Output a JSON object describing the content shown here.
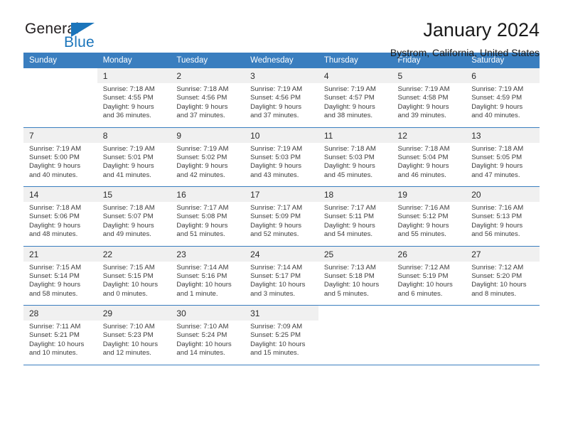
{
  "brand": {
    "name_part1": "General",
    "name_part2": "Blue",
    "triangle_icon": "triangle-icon",
    "accent_color": "#1b75bb"
  },
  "header": {
    "title": "January 2024",
    "subtitle": "Bystrom, California, United States"
  },
  "calendar": {
    "header_color": "#3a7ebf",
    "daynum_band_color": "#f0f0f0",
    "weekday_headers": [
      "Sunday",
      "Monday",
      "Tuesday",
      "Wednesday",
      "Thursday",
      "Friday",
      "Saturday"
    ],
    "weeks": [
      {
        "days": [
          {
            "num": "",
            "sunrise": "",
            "sunset": "",
            "daylight1": "",
            "daylight2": ""
          },
          {
            "num": "1",
            "sunrise": "Sunrise: 7:18 AM",
            "sunset": "Sunset: 4:55 PM",
            "daylight1": "Daylight: 9 hours",
            "daylight2": "and 36 minutes."
          },
          {
            "num": "2",
            "sunrise": "Sunrise: 7:18 AM",
            "sunset": "Sunset: 4:56 PM",
            "daylight1": "Daylight: 9 hours",
            "daylight2": "and 37 minutes."
          },
          {
            "num": "3",
            "sunrise": "Sunrise: 7:19 AM",
            "sunset": "Sunset: 4:56 PM",
            "daylight1": "Daylight: 9 hours",
            "daylight2": "and 37 minutes."
          },
          {
            "num": "4",
            "sunrise": "Sunrise: 7:19 AM",
            "sunset": "Sunset: 4:57 PM",
            "daylight1": "Daylight: 9 hours",
            "daylight2": "and 38 minutes."
          },
          {
            "num": "5",
            "sunrise": "Sunrise: 7:19 AM",
            "sunset": "Sunset: 4:58 PM",
            "daylight1": "Daylight: 9 hours",
            "daylight2": "and 39 minutes."
          },
          {
            "num": "6",
            "sunrise": "Sunrise: 7:19 AM",
            "sunset": "Sunset: 4:59 PM",
            "daylight1": "Daylight: 9 hours",
            "daylight2": "and 40 minutes."
          }
        ]
      },
      {
        "days": [
          {
            "num": "7",
            "sunrise": "Sunrise: 7:19 AM",
            "sunset": "Sunset: 5:00 PM",
            "daylight1": "Daylight: 9 hours",
            "daylight2": "and 40 minutes."
          },
          {
            "num": "8",
            "sunrise": "Sunrise: 7:19 AM",
            "sunset": "Sunset: 5:01 PM",
            "daylight1": "Daylight: 9 hours",
            "daylight2": "and 41 minutes."
          },
          {
            "num": "9",
            "sunrise": "Sunrise: 7:19 AM",
            "sunset": "Sunset: 5:02 PM",
            "daylight1": "Daylight: 9 hours",
            "daylight2": "and 42 minutes."
          },
          {
            "num": "10",
            "sunrise": "Sunrise: 7:19 AM",
            "sunset": "Sunset: 5:03 PM",
            "daylight1": "Daylight: 9 hours",
            "daylight2": "and 43 minutes."
          },
          {
            "num": "11",
            "sunrise": "Sunrise: 7:18 AM",
            "sunset": "Sunset: 5:03 PM",
            "daylight1": "Daylight: 9 hours",
            "daylight2": "and 45 minutes."
          },
          {
            "num": "12",
            "sunrise": "Sunrise: 7:18 AM",
            "sunset": "Sunset: 5:04 PM",
            "daylight1": "Daylight: 9 hours",
            "daylight2": "and 46 minutes."
          },
          {
            "num": "13",
            "sunrise": "Sunrise: 7:18 AM",
            "sunset": "Sunset: 5:05 PM",
            "daylight1": "Daylight: 9 hours",
            "daylight2": "and 47 minutes."
          }
        ]
      },
      {
        "days": [
          {
            "num": "14",
            "sunrise": "Sunrise: 7:18 AM",
            "sunset": "Sunset: 5:06 PM",
            "daylight1": "Daylight: 9 hours",
            "daylight2": "and 48 minutes."
          },
          {
            "num": "15",
            "sunrise": "Sunrise: 7:18 AM",
            "sunset": "Sunset: 5:07 PM",
            "daylight1": "Daylight: 9 hours",
            "daylight2": "and 49 minutes."
          },
          {
            "num": "16",
            "sunrise": "Sunrise: 7:17 AM",
            "sunset": "Sunset: 5:08 PM",
            "daylight1": "Daylight: 9 hours",
            "daylight2": "and 51 minutes."
          },
          {
            "num": "17",
            "sunrise": "Sunrise: 7:17 AM",
            "sunset": "Sunset: 5:09 PM",
            "daylight1": "Daylight: 9 hours",
            "daylight2": "and 52 minutes."
          },
          {
            "num": "18",
            "sunrise": "Sunrise: 7:17 AM",
            "sunset": "Sunset: 5:11 PM",
            "daylight1": "Daylight: 9 hours",
            "daylight2": "and 54 minutes."
          },
          {
            "num": "19",
            "sunrise": "Sunrise: 7:16 AM",
            "sunset": "Sunset: 5:12 PM",
            "daylight1": "Daylight: 9 hours",
            "daylight2": "and 55 minutes."
          },
          {
            "num": "20",
            "sunrise": "Sunrise: 7:16 AM",
            "sunset": "Sunset: 5:13 PM",
            "daylight1": "Daylight: 9 hours",
            "daylight2": "and 56 minutes."
          }
        ]
      },
      {
        "days": [
          {
            "num": "21",
            "sunrise": "Sunrise: 7:15 AM",
            "sunset": "Sunset: 5:14 PM",
            "daylight1": "Daylight: 9 hours",
            "daylight2": "and 58 minutes."
          },
          {
            "num": "22",
            "sunrise": "Sunrise: 7:15 AM",
            "sunset": "Sunset: 5:15 PM",
            "daylight1": "Daylight: 10 hours",
            "daylight2": "and 0 minutes."
          },
          {
            "num": "23",
            "sunrise": "Sunrise: 7:14 AM",
            "sunset": "Sunset: 5:16 PM",
            "daylight1": "Daylight: 10 hours",
            "daylight2": "and 1 minute."
          },
          {
            "num": "24",
            "sunrise": "Sunrise: 7:14 AM",
            "sunset": "Sunset: 5:17 PM",
            "daylight1": "Daylight: 10 hours",
            "daylight2": "and 3 minutes."
          },
          {
            "num": "25",
            "sunrise": "Sunrise: 7:13 AM",
            "sunset": "Sunset: 5:18 PM",
            "daylight1": "Daylight: 10 hours",
            "daylight2": "and 5 minutes."
          },
          {
            "num": "26",
            "sunrise": "Sunrise: 7:12 AM",
            "sunset": "Sunset: 5:19 PM",
            "daylight1": "Daylight: 10 hours",
            "daylight2": "and 6 minutes."
          },
          {
            "num": "27",
            "sunrise": "Sunrise: 7:12 AM",
            "sunset": "Sunset: 5:20 PM",
            "daylight1": "Daylight: 10 hours",
            "daylight2": "and 8 minutes."
          }
        ]
      },
      {
        "days": [
          {
            "num": "28",
            "sunrise": "Sunrise: 7:11 AM",
            "sunset": "Sunset: 5:21 PM",
            "daylight1": "Daylight: 10 hours",
            "daylight2": "and 10 minutes."
          },
          {
            "num": "29",
            "sunrise": "Sunrise: 7:10 AM",
            "sunset": "Sunset: 5:23 PM",
            "daylight1": "Daylight: 10 hours",
            "daylight2": "and 12 minutes."
          },
          {
            "num": "30",
            "sunrise": "Sunrise: 7:10 AM",
            "sunset": "Sunset: 5:24 PM",
            "daylight1": "Daylight: 10 hours",
            "daylight2": "and 14 minutes."
          },
          {
            "num": "31",
            "sunrise": "Sunrise: 7:09 AM",
            "sunset": "Sunset: 5:25 PM",
            "daylight1": "Daylight: 10 hours",
            "daylight2": "and 15 minutes."
          },
          {
            "num": "",
            "sunrise": "",
            "sunset": "",
            "daylight1": "",
            "daylight2": ""
          },
          {
            "num": "",
            "sunrise": "",
            "sunset": "",
            "daylight1": "",
            "daylight2": ""
          },
          {
            "num": "",
            "sunrise": "",
            "sunset": "",
            "daylight1": "",
            "daylight2": ""
          }
        ]
      }
    ]
  }
}
